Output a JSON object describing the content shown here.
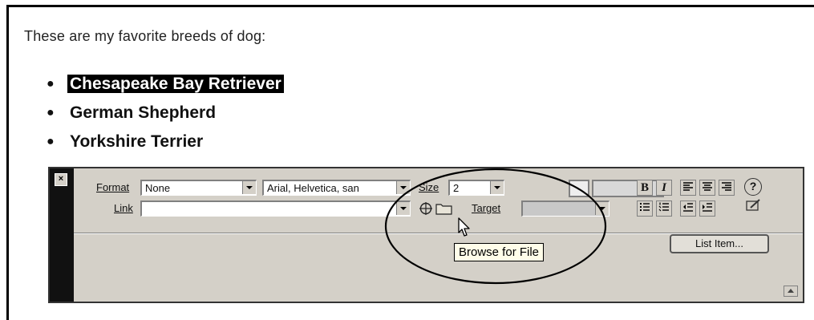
{
  "document": {
    "intro": "These are my favorite breeds of dog:",
    "breeds": [
      {
        "label": "Chesapeake Bay Retriever",
        "selected": true
      },
      {
        "label": "German Shepherd",
        "selected": false
      },
      {
        "label": "Yorkshire Terrier",
        "selected": false
      }
    ]
  },
  "inspector": {
    "close_icon": "×",
    "format_label": "Format",
    "format_value": "None",
    "font_value": "Arial, Helvetica, san",
    "size_label": "Size",
    "size_value": "2",
    "link_label": "Link",
    "link_value": "",
    "target_label": "Target",
    "target_value": "",
    "bold_label": "B",
    "italic_label": "I",
    "help_icon": "?",
    "list_item_button": "List Item...",
    "tooltip": "Browse for File",
    "icons": {
      "point_to_file": "point-to-file-icon",
      "browse_folder": "folder-icon",
      "align_left": "align-left-icon",
      "align_center": "align-center-icon",
      "align_right": "align-right-icon",
      "unordered_list": "unordered-list-icon",
      "ordered_list": "ordered-list-icon",
      "outdent": "outdent-icon",
      "indent": "indent-icon",
      "quick_tag_editor": "edit-icon",
      "expand": "expand-arrow-icon"
    }
  },
  "colors": {
    "panel": "#d4d0c8",
    "selection": "#000000",
    "tooltip_bg": "#fffde9"
  }
}
